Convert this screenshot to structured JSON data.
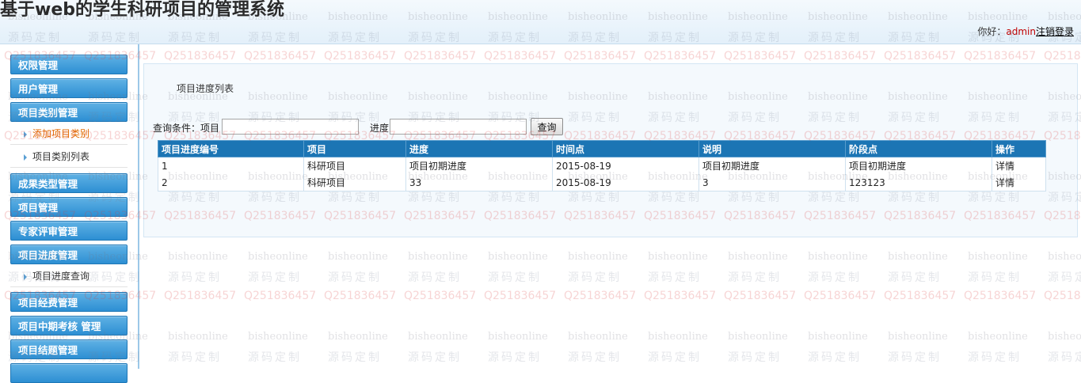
{
  "header": {
    "site_title": "基于web的学生科研项目的管理系统",
    "greeting": "你好：",
    "username": "admin",
    "logout_label": "注销登录"
  },
  "sidebar": {
    "menus": [
      {
        "label": "权限管理"
      },
      {
        "label": "用户管理"
      },
      {
        "label": "项目类别管理",
        "items": [
          {
            "label": "添加项目类别",
            "active": true
          },
          {
            "label": "项目类别列表",
            "active": false
          }
        ]
      },
      {
        "label": "成果类型管理"
      },
      {
        "label": "项目管理"
      },
      {
        "label": "专家评审管理"
      },
      {
        "label": "项目进度管理",
        "items": [
          {
            "label": "项目进度查询",
            "active": false
          }
        ]
      },
      {
        "label": "项目经费管理"
      },
      {
        "label": "项目中期考核 管理"
      },
      {
        "label": "项目结题管理"
      }
    ]
  },
  "main": {
    "list_title": "项目进度列表",
    "query_label": "查询条件：项目",
    "progress_label": "进度",
    "project_input_value": "",
    "progress_input_value": "",
    "query_button": "查询",
    "table": {
      "headers": [
        "项目进度编号",
        "项目",
        "进度",
        "时间点",
        "说明",
        "阶段点",
        "操作"
      ],
      "rows": [
        [
          "1",
          "科研项目",
          "项目初期进度",
          "2015-08-19",
          "项目初期进度",
          "项目初期进度",
          "详情"
        ],
        [
          "2",
          "科研项目",
          "33",
          "2015-08-19",
          "3",
          "123123",
          "详情"
        ]
      ]
    }
  },
  "watermark": {
    "text_a": "bisheonline",
    "text_b": "源码定制",
    "text_c": "Q251836457"
  },
  "colors": {
    "menu_header": "#2d8fd3",
    "table_header": "#1c75b4",
    "active_item": "#e26a00",
    "username": "#c00000"
  }
}
